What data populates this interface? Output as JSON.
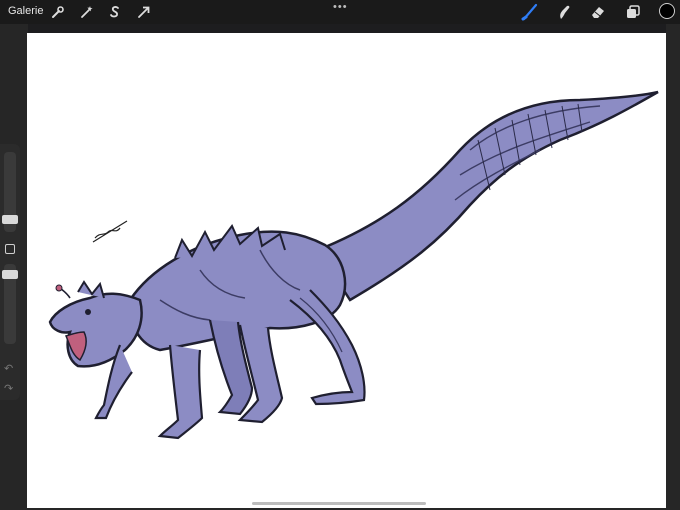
{
  "toolbar": {
    "gallery_label": "Galerie",
    "more_label": "•••",
    "left_tools": [
      {
        "name": "wrench-icon"
      },
      {
        "name": "magic-wand-icon"
      },
      {
        "name": "selection-s-icon"
      },
      {
        "name": "transform-arrow-icon"
      }
    ],
    "right_tools": [
      {
        "name": "brush-icon",
        "active": true
      },
      {
        "name": "smudge-icon"
      },
      {
        "name": "eraser-icon"
      },
      {
        "name": "layers-icon"
      }
    ],
    "current_color": "#000000",
    "active_tool_color": "#2f7df6"
  },
  "sidebar": {
    "undo_label": "↶",
    "redo_label": "↷"
  },
  "canvas": {
    "background": "#ffffff",
    "drawing": {
      "subject": "creature-sketch",
      "fill_color": "#8c8cc4",
      "dark_color": "#3c3c64",
      "mouth_color": "#c0607e"
    }
  }
}
